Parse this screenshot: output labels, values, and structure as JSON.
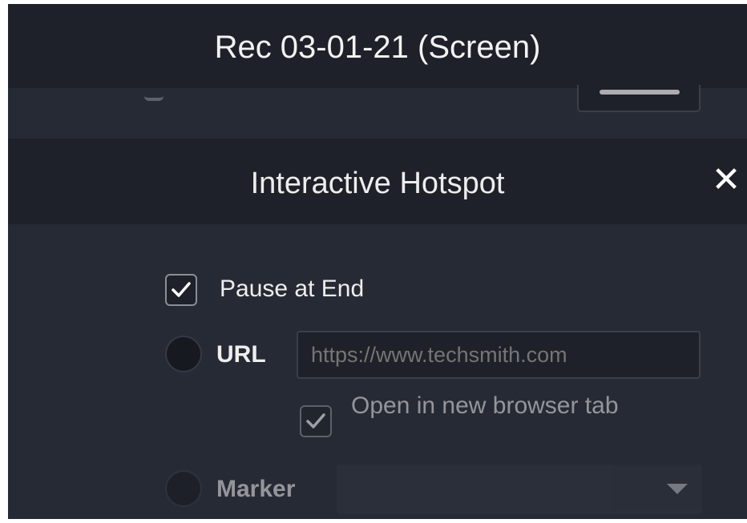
{
  "window": {
    "title": "Rec 03-01-21 (Screen)"
  },
  "panel": {
    "title": "Interactive Hotspot",
    "close_label": "✕"
  },
  "options": {
    "pause_at_end": {
      "label": "Pause at End",
      "checked": true
    },
    "url": {
      "label": "URL",
      "selected": false,
      "placeholder": "https://www.techsmith.com",
      "value": "",
      "open_new_tab": {
        "label": "Open in new browser tab",
        "checked": true
      }
    },
    "marker": {
      "label": "Marker",
      "selected": false,
      "value": ""
    }
  },
  "colors": {
    "background": "#262a35",
    "header": "#1e2129",
    "text": "#eeeeee"
  }
}
